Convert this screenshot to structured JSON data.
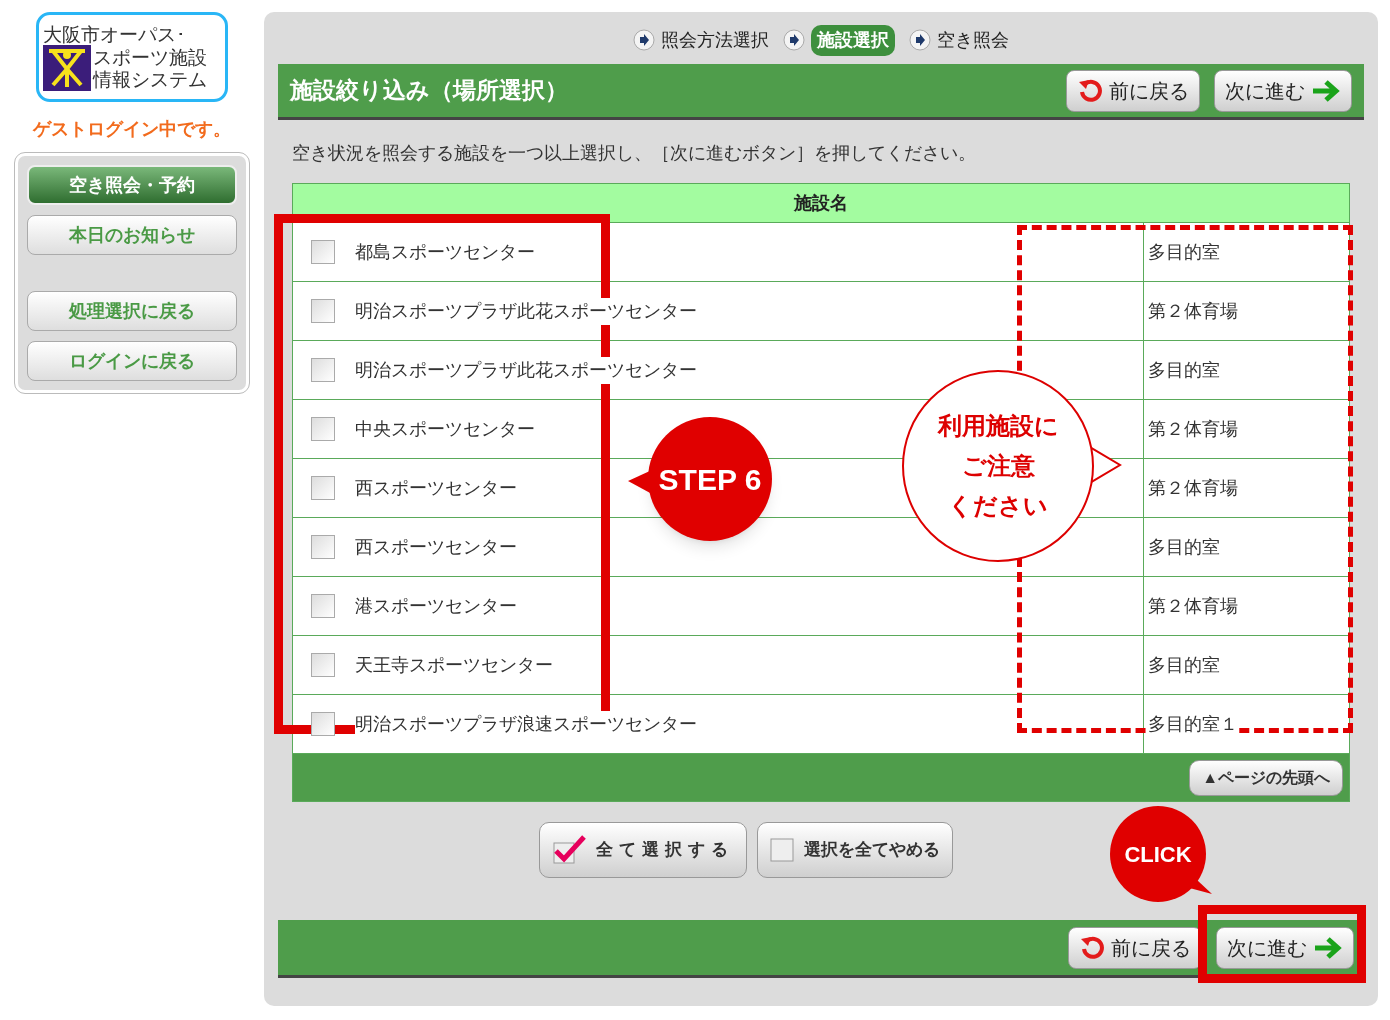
{
  "logo": {
    "lines": [
      "大阪市オーパス･",
      "スポーツ施設",
      "情報システム"
    ]
  },
  "login_status": "ゲストログイン中です。",
  "sidebar": {
    "groups": [
      [
        {
          "label": "空き照会・予約",
          "selected": true
        },
        {
          "label": "本日のお知らせ",
          "selected": false
        }
      ],
      [
        {
          "label": "処理選択に戻る",
          "selected": false
        },
        {
          "label": "ログインに戻る",
          "selected": false
        }
      ]
    ]
  },
  "steps": [
    {
      "label": "照会方法選択",
      "selected": false
    },
    {
      "label": "施設選択",
      "selected": true
    },
    {
      "label": "空き照会",
      "selected": false
    }
  ],
  "header": {
    "title": "施設絞り込み（場所選択）",
    "back_button": "前に戻る",
    "next_button": "次に進む"
  },
  "instruction": "空き状況を照会する施設を一つ以上選択し、［次に進むボタン］を押してください。",
  "table": {
    "columns": [
      "施設名"
    ],
    "rows": [
      {
        "name": "都島スポーツセンター",
        "room": "多目的室",
        "checked": false
      },
      {
        "name": "明治スポーツプラザ此花スポーツセンター",
        "room": "第２体育場",
        "checked": false
      },
      {
        "name": "明治スポーツプラザ此花スポーツセンター",
        "room": "多目的室",
        "checked": false
      },
      {
        "name": "中央スポーツセンター",
        "room": "第２体育場",
        "checked": false
      },
      {
        "name": "西スポーツセンター",
        "room": "第２体育場",
        "checked": false
      },
      {
        "name": "西スポーツセンター",
        "room": "多目的室",
        "checked": false
      },
      {
        "name": "港スポーツセンター",
        "room": "第２体育場",
        "checked": false
      },
      {
        "name": "天王寺スポーツセンター",
        "room": "多目的室",
        "checked": false
      },
      {
        "name": "明治スポーツプラザ浪速スポーツセンター",
        "room": "多目的室１",
        "checked": false
      }
    ]
  },
  "page_top_button": "▲ページの先頭へ",
  "select_all_button": "全て選択する",
  "clear_all_button": "選択を全てやめる",
  "footer": {
    "back_button": "前に戻る",
    "next_button": "次に進む"
  },
  "annotations": {
    "step_badge": "STEP 6",
    "notice_bubble": [
      "利用施設に",
      "ご注意",
      "ください"
    ],
    "click_badge": "CLICK"
  }
}
